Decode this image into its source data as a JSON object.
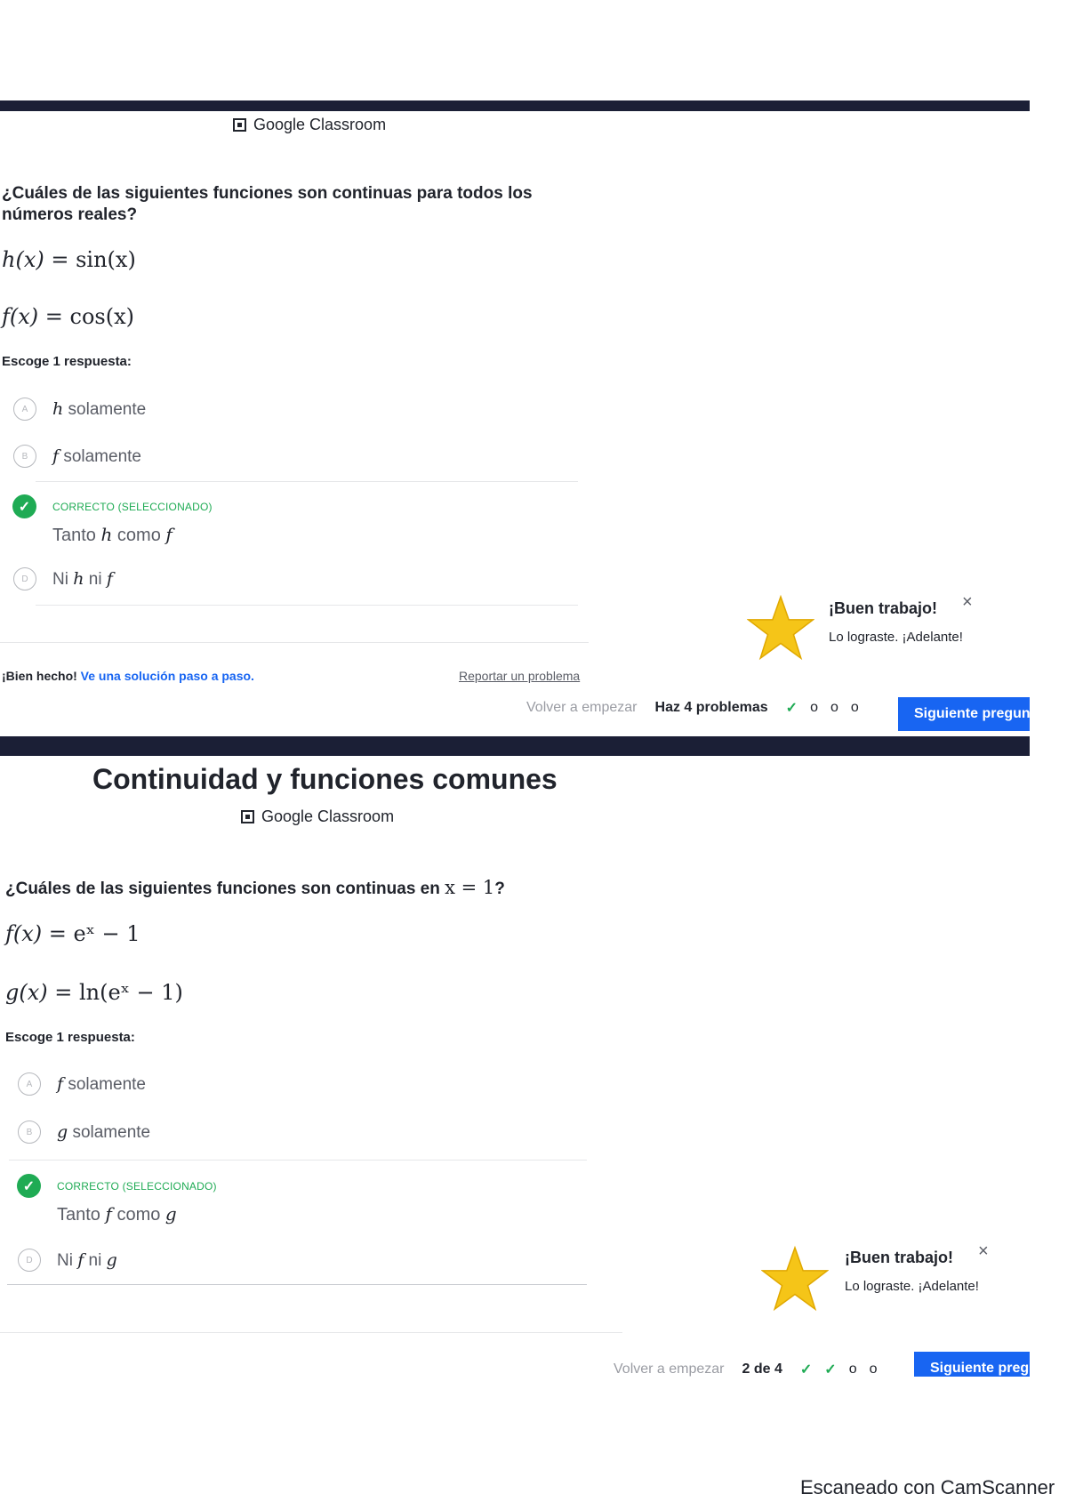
{
  "google_classroom": "Google Classroom",
  "choose_label": "Escoge 1 respuesta:",
  "correct_label": "CORRECTO (SELECCIONADO)",
  "toast": {
    "title": "¡Buen trabajo!",
    "subtitle": "Lo lograste. ¡Adelante!",
    "close": "×"
  },
  "top": {
    "question": "¿Cuáles de las siguientes funciones son continuas para todos los números reales?",
    "eq1": {
      "name": "h(x)",
      "rhs": "= sin(x)"
    },
    "eq2": {
      "name": "f(x)",
      "rhs": "= cos(x)"
    },
    "choices": [
      {
        "letter": "A",
        "var": "h",
        "text": " solamente"
      },
      {
        "letter": "B",
        "var": "f",
        "text": " solamente"
      },
      {
        "letter": "D",
        "pre": "Ni ",
        "var1": "h",
        "mid": " ni ",
        "var2": "f"
      }
    ],
    "correct": {
      "pre": "Tanto ",
      "var1": "h",
      "mid": " como ",
      "var2": "f"
    },
    "bien_hecho": "¡Bien hecho!",
    "solution_link": "Ve una solución paso a paso.",
    "report": "Reportar un problema",
    "restart": "Volver a empezar",
    "count": "Haz 4 problemas",
    "progress": [
      "✓",
      "o",
      "o",
      "o"
    ],
    "next": "Siguiente pregun"
  },
  "bottom": {
    "title": "Continuidad y funciones comunes",
    "question_pre": "¿Cuáles de las siguientes funciones son continuas en ",
    "question_math": "x = 1",
    "question_post": "?",
    "eq1": {
      "name": "f(x)",
      "rhs": "= eˣ − 1"
    },
    "eq2": {
      "name": "g(x)",
      "rhs": "= ln(eˣ − 1)"
    },
    "choose_label": "Escoge 1 respuesta:",
    "choices": [
      {
        "letter": "A",
        "var": "f",
        "text": " solamente"
      },
      {
        "letter": "B",
        "var": "g",
        "text": " solamente"
      },
      {
        "letter": "D",
        "pre": "Ni ",
        "var1": "f",
        "mid": " ni ",
        "var2": "g"
      }
    ],
    "correct": {
      "pre": "Tanto ",
      "var1": "f",
      "mid": " como ",
      "var2": "g"
    },
    "restart": "Volver a empezar",
    "count": "2 de 4",
    "progress": [
      "✓",
      "✓",
      "o",
      "o"
    ],
    "next": "Siguiente preg"
  },
  "scanner": "Escaneado con CamScanner"
}
